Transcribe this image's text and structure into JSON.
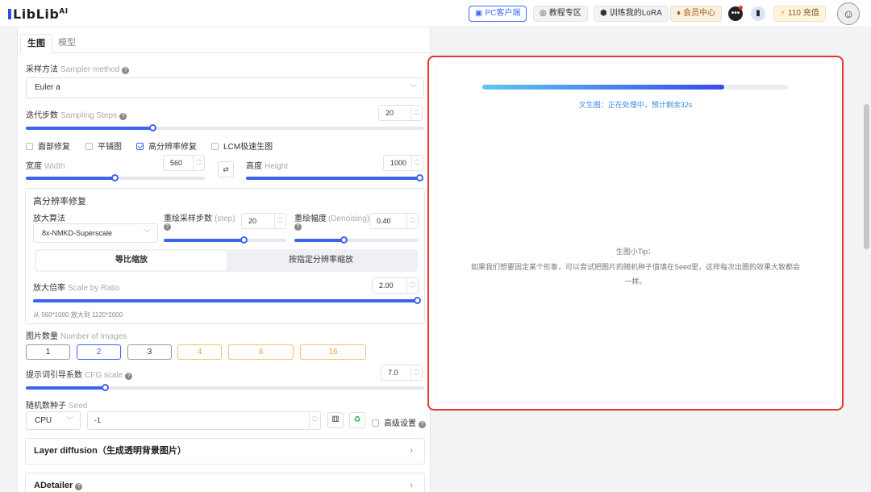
{
  "header": {
    "logo_main": "LibLib",
    "logo_ai": "AI",
    "pc_client": "PC客户端",
    "tutorial": "教程专区",
    "train_lora": "训练我的LoRA",
    "vip_center": "会员中心",
    "coins": "110 充值"
  },
  "tabs": {
    "generate": "生图",
    "model": "模型"
  },
  "sampler": {
    "label": "采样方法",
    "label_en": "Sampler method",
    "value": "Euler a"
  },
  "steps": {
    "label": "迭代步数",
    "label_en": "Sampling Steps",
    "value": "20",
    "fraction": 0.32
  },
  "options": {
    "face_fix": {
      "label": "面部修复",
      "checked": false
    },
    "tiling": {
      "label": "平铺图",
      "checked": false
    },
    "hires_fix": {
      "label": "高分辨率修复",
      "checked": true
    },
    "lcm": {
      "label": "LCM极速生图",
      "checked": false
    }
  },
  "width": {
    "label": "宽度",
    "label_en": "Width",
    "value": "560",
    "fraction": 0.5
  },
  "height": {
    "label": "高度",
    "label_en": "Height",
    "value": "1000",
    "fraction": 1.0
  },
  "hires": {
    "title": "高分辨率修复",
    "upscaler_label": "放大算法",
    "upscaler_value": "8x-NMKD-Superscale",
    "steps_label": "重绘采样步数",
    "steps_label_en": "(step)",
    "steps_value": "20",
    "steps_fraction": 0.66,
    "denoise_label": "重绘幅度",
    "denoise_label_en": "(Denoising)",
    "denoise_value": "0.40",
    "denoise_fraction": 0.4,
    "mode_ratio": "等比缩放",
    "mode_resolution": "按指定分辨率缩放",
    "scale_label": "放大倍率",
    "scale_label_en": "Scale by Ratio",
    "scale_value": "2.00",
    "scale_fraction": 1.0,
    "size_note": "从 560*1000 放大到 1120*2000"
  },
  "images": {
    "label": "图片数量",
    "label_en": "Number of Images",
    "options": [
      "1",
      "2",
      "3",
      "4",
      "8",
      "16"
    ],
    "selected": "2"
  },
  "cfg": {
    "label": "提示词引导系数",
    "label_en": "CFG scale",
    "value": "7.0",
    "fraction": 0.2
  },
  "seed": {
    "label": "随机数种子",
    "label_en": "Seed",
    "device": "CPU",
    "value": "-1",
    "advanced_label": "高级设置"
  },
  "accordions": {
    "layer_diffusion": "Layer diffusion（生成透明背景图片）",
    "adetailer": "ADetailer"
  },
  "progress": {
    "fraction": 0.79,
    "status_text": "文生图：正在处理中，预计剩余32s"
  },
  "tip": {
    "title": "生图小Tip：",
    "body": "如果我们想要固定某个形象，可以尝试把图片的随机种子值填在Seed里，这样每次出图的效果大致都会一样。"
  },
  "colors": {
    "accent": "#3d62ee",
    "highlight_border": "#e03a2c",
    "status_blue": "#3b8be8",
    "gold": "#e8a43a"
  }
}
